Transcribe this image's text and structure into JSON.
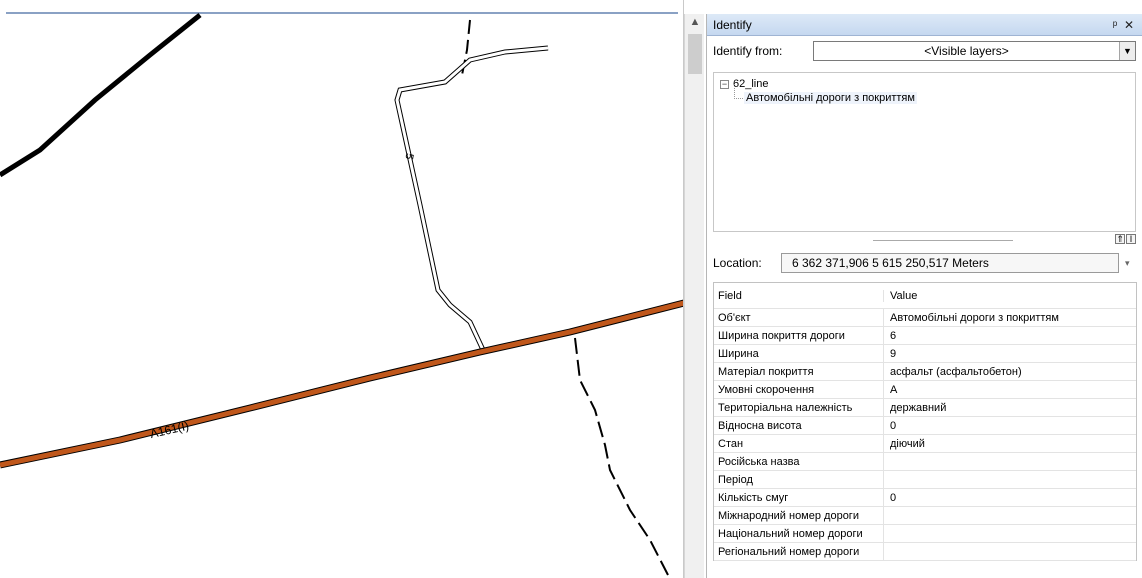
{
  "map": {
    "road_label_main": "A161(I)",
    "road_label_side": "5"
  },
  "identify": {
    "title": "Identify",
    "pin_icon": "pin-icon",
    "close_icon": "close-icon",
    "from_label": "Identify from:",
    "from_value": "<Visible layers>",
    "tree": {
      "layer": "62_line",
      "feature": "Автомобільні дороги з покриттям"
    },
    "location_label": "Location:",
    "location_value": "6 362 371,906  5 615 250,517 Meters",
    "table": {
      "header_field": "Field",
      "header_value": "Value",
      "rows": [
        {
          "field": "Об'єкт",
          "value": "Автомобільні дороги з покриттям"
        },
        {
          "field": "Ширина покриття дороги",
          "value": "6"
        },
        {
          "field": "Ширина",
          "value": "9"
        },
        {
          "field": "Матеріал покриття",
          "value": "асфальт (асфальтобетон)"
        },
        {
          "field": "Умовні скорочення",
          "value": "А"
        },
        {
          "field": "Територіальна належність",
          "value": "державний"
        },
        {
          "field": "Відносна висота",
          "value": "0"
        },
        {
          "field": "Стан",
          "value": "діючий"
        },
        {
          "field": "Російська назва",
          "value": ""
        },
        {
          "field": "Період",
          "value": ""
        },
        {
          "field": "Кількість смуг",
          "value": "0"
        },
        {
          "field": "Міжнародний номер дороги",
          "value": ""
        },
        {
          "field": "Національний номер дороги",
          "value": ""
        },
        {
          "field": "Регіональний номер дороги",
          "value": ""
        }
      ]
    }
  },
  "colors": {
    "main_road": "#c0571b",
    "panel_title_bg": "#c5d8f0"
  }
}
